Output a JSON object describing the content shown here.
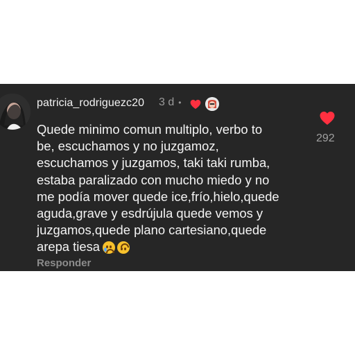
{
  "comment": {
    "username": "patricia_rodriguezc20",
    "time": "3 d",
    "text": "Quede minimo comun multiplo, verbo to\nbe, escuchamos y no juzgamoz,\nescuchamos y juzgamos, taki taki rumba,\nestaba paralizado con mucho miedo y no\nme podía mover quede ice,frío,hielo,quede\naguda,grave y esdrújula quede vemos y\njuzgamos,quede plano cartesiano,quede\narepa tiesa",
    "reply_label": "Responder",
    "like_count": "292"
  },
  "icons": {
    "author_like": "heart-icon",
    "author_badge": "profile-badge-icon",
    "emoji_1": "sad-tear-emoji",
    "emoji_2": "upside-down-face-emoji",
    "like": "heart-icon"
  },
  "colors": {
    "panel_bg": "#262626",
    "heart": "#ff3040",
    "text": "#f4f4f4",
    "secondary": "#8c8c8c"
  }
}
